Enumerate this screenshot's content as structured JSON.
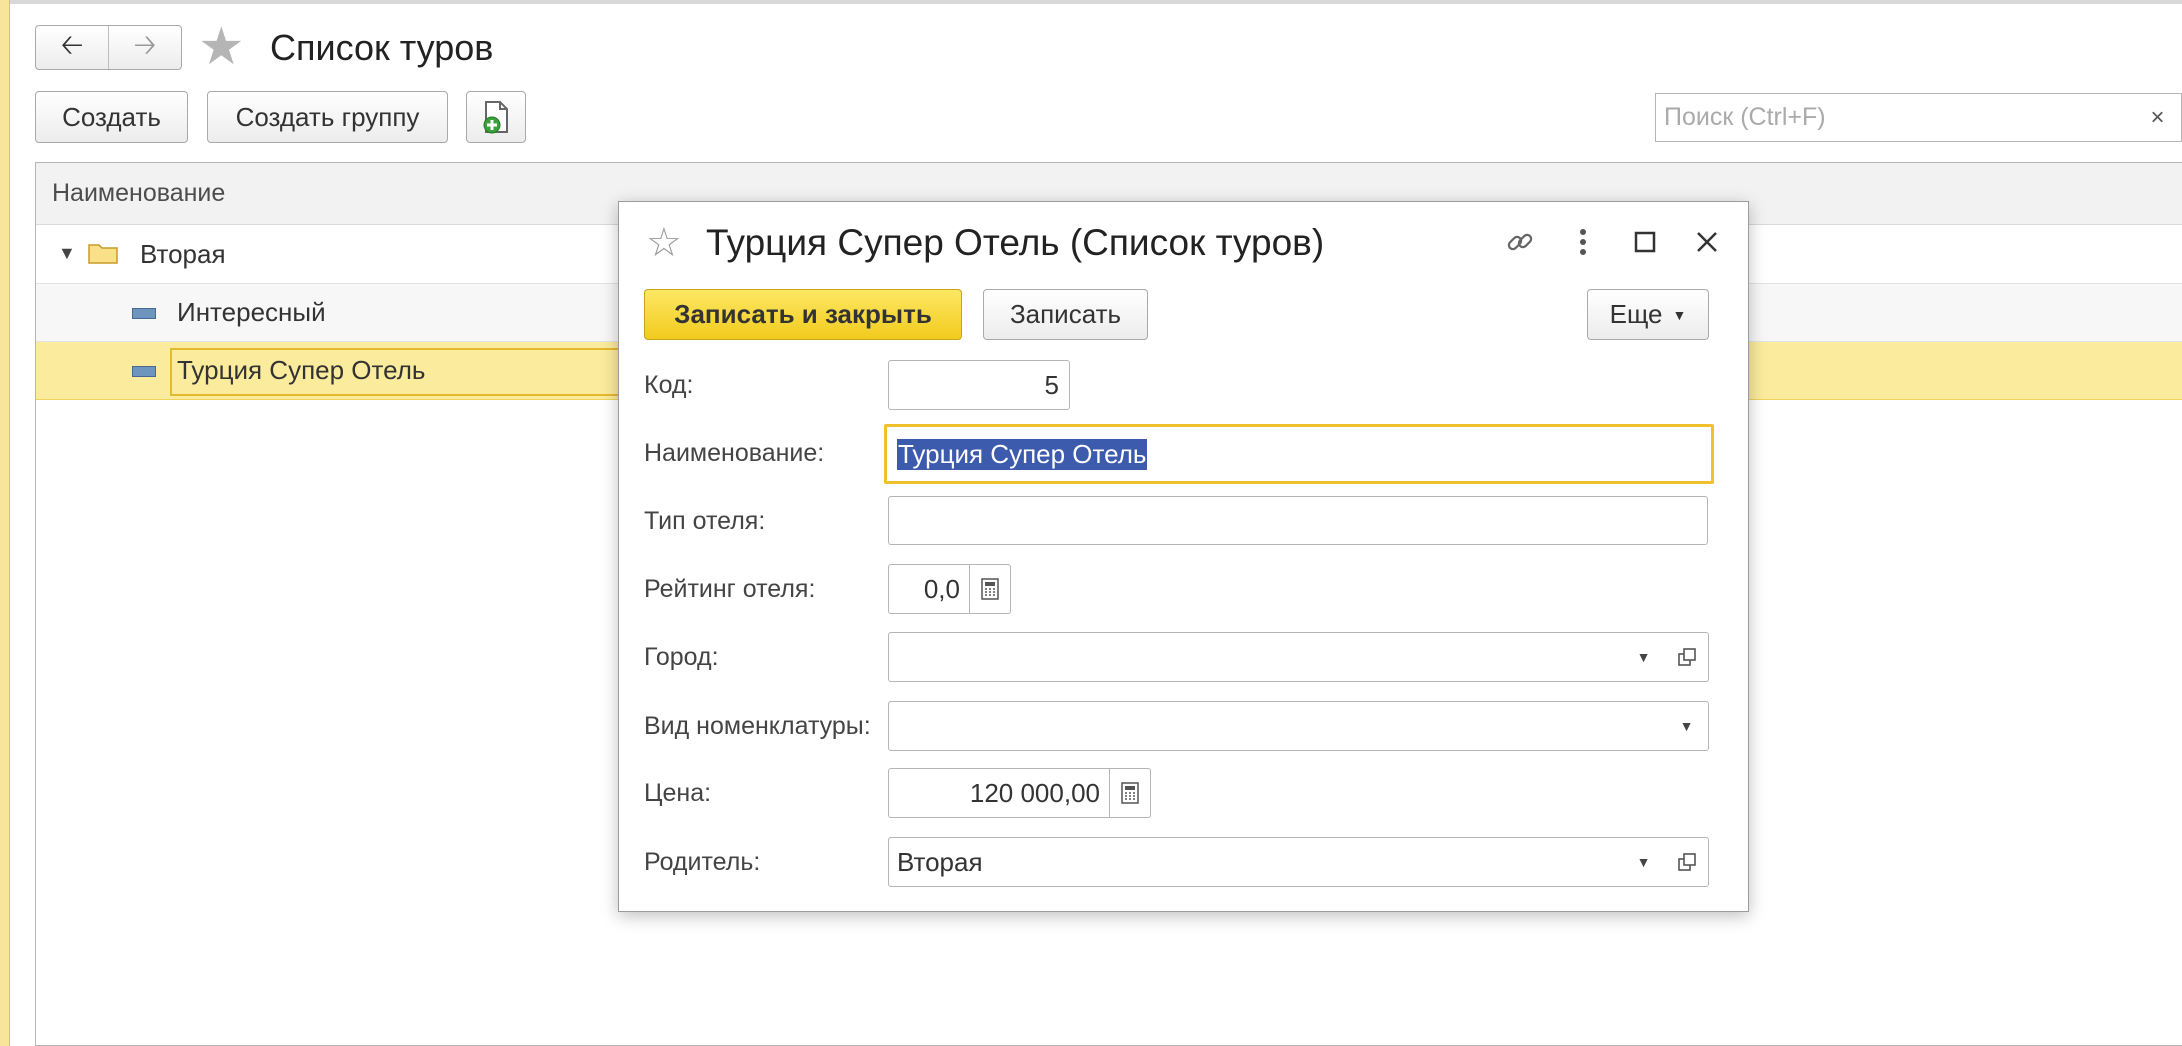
{
  "page": {
    "title": "Список туров",
    "nav": {
      "back_icon": "arrow-left-icon",
      "forward_icon": "arrow-right-icon"
    },
    "toolbar": {
      "create_label": "Создать",
      "create_group_label": "Создать группу",
      "doc_icon": "new-document-icon"
    },
    "search": {
      "placeholder": "Поиск (Ctrl+F)",
      "clear_label": "×"
    }
  },
  "list": {
    "column_header": "Наименование",
    "rows": [
      {
        "label": "Вторая",
        "kind": "group",
        "expanded": true
      },
      {
        "label": "Интересный",
        "kind": "item"
      },
      {
        "label": "Турция Супер Отель",
        "kind": "item",
        "selected": true
      }
    ]
  },
  "dialog": {
    "title": "Турция Супер Отель (Список туров)",
    "buttons": {
      "save_close": "Записать и закрыть",
      "save": "Записать",
      "more": "Еще"
    },
    "fields": {
      "code": {
        "label": "Код:",
        "value": "5"
      },
      "name": {
        "label": "Наименование:",
        "value": "Турция Супер Отель"
      },
      "hotel_type": {
        "label": "Тип отеля:",
        "value": ""
      },
      "rating": {
        "label": "Рейтинг отеля:",
        "value": "0,0"
      },
      "city": {
        "label": "Город:",
        "value": ""
      },
      "nomenclature_kind": {
        "label": "Вид номенклатуры:",
        "value": ""
      },
      "price": {
        "label": "Цена:",
        "value": "120 000,00"
      },
      "parent": {
        "label": "Родитель:",
        "value": "Вторая"
      }
    }
  },
  "colors": {
    "accent_yellow": "#f1cb1d",
    "selection_row": "#fbeb9c",
    "text_selection": "#3d5bad"
  }
}
